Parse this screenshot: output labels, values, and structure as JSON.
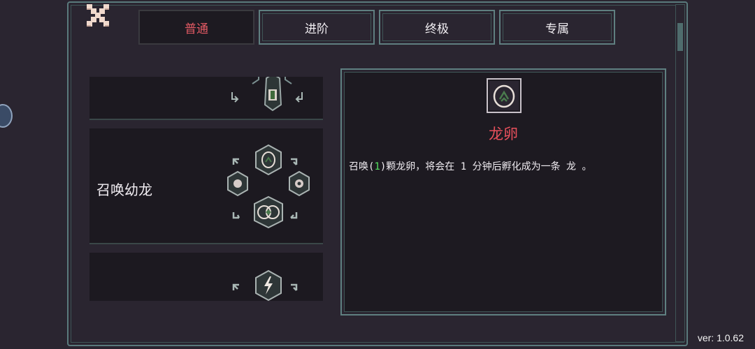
{
  "tabs": [
    {
      "label": "普通",
      "active": true
    },
    {
      "label": "进阶",
      "active": false
    },
    {
      "label": "终极",
      "active": false
    },
    {
      "label": "专属",
      "active": false
    }
  ],
  "skills": [
    {
      "title": ""
    },
    {
      "title": "召唤幼龙"
    },
    {
      "title": ""
    }
  ],
  "detail": {
    "icon": "dragon-egg-icon",
    "name": "龙卵",
    "desc_before": "召唤(",
    "desc_highlight": "1",
    "desc_after": ")颗龙卵，将会在 1 分钟后孵化成为一条 龙 。"
  },
  "version": "ver: 1.0.62",
  "colors": {
    "accent_red": "#e45a64",
    "highlight_green": "#54e05e",
    "frame_teal": "#5f8081"
  }
}
